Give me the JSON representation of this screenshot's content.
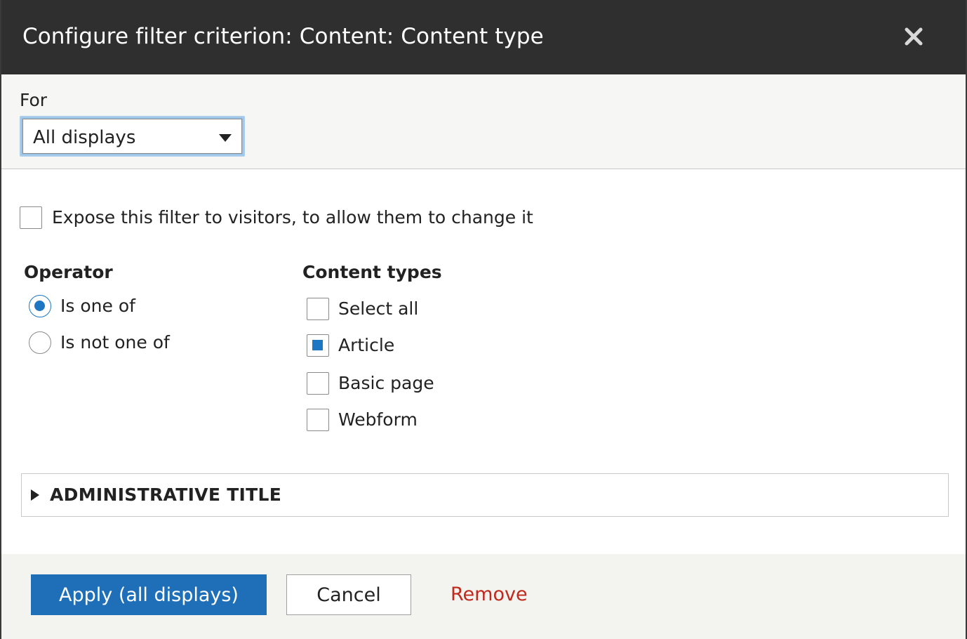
{
  "dialog": {
    "title": "Configure filter criterion: Content: Content type"
  },
  "for_section": {
    "label": "For",
    "select_value": "All displays"
  },
  "expose": {
    "label": "Expose this filter to visitors, to allow them to change it",
    "checked": false
  },
  "operator": {
    "heading": "Operator",
    "options": [
      {
        "label": "Is one of",
        "selected": true
      },
      {
        "label": "Is not one of",
        "selected": false
      }
    ]
  },
  "content_types": {
    "heading": "Content types",
    "options": [
      {
        "label": "Select all",
        "checked": false
      },
      {
        "label": "Article",
        "checked": true
      },
      {
        "label": "Basic page",
        "checked": false
      },
      {
        "label": "Webform",
        "checked": false
      }
    ]
  },
  "admin_title": {
    "label": "ADMINISTRATIVE TITLE"
  },
  "footer": {
    "apply_label": "Apply (all displays)",
    "cancel_label": "Cancel",
    "remove_label": "Remove"
  },
  "colors": {
    "titlebar": "#2f2f2f",
    "accent": "#1e77c2",
    "primary_button": "#1e6fb8",
    "remove_link": "#c0291c"
  }
}
